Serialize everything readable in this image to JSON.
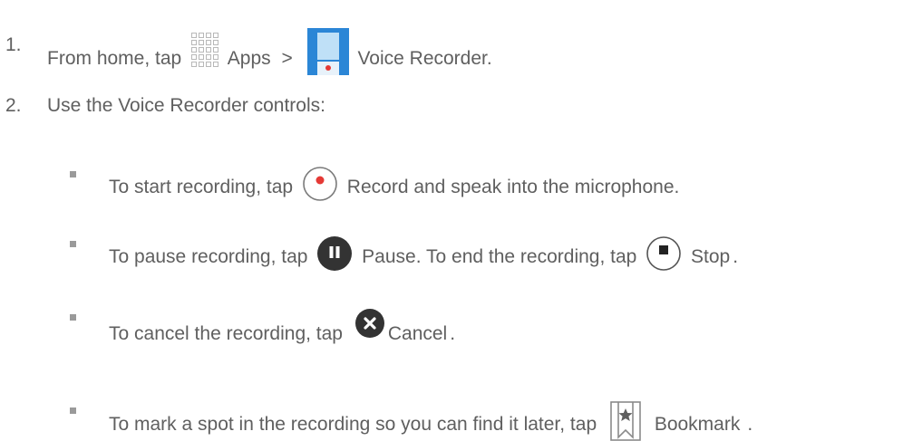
{
  "steps": [
    {
      "number": "1.",
      "text_before": "From home, tap",
      "apps_label": "Apps",
      "separator": ">",
      "recorder_label": "Voice",
      "recorder_label2": "Recorder."
    },
    {
      "number": "2.",
      "text": "Use the Voice Recorder controls:"
    }
  ],
  "bullets": [
    {
      "before": "To start recording, tap",
      "icon": "record-icon",
      "after": "Record  and speak into the microphone."
    },
    {
      "before": "To pause recording, tap",
      "icon": "pause-icon",
      "middle": "Pause. To end the recording, tap",
      "icon2": "stop-icon",
      "after": "Stop",
      "end": "."
    },
    {
      "before": "To cancel the recording, tap",
      "icon": "cancel-icon",
      "after": "Cancel",
      "end": "."
    },
    {
      "before": "To mark a spot in the recording so you can find it later, tap",
      "icon": "bookmark-icon",
      "after": "Bookmark",
      "end": "."
    }
  ],
  "colors": {
    "text": "#5f5f5f",
    "record_red": "#e53935",
    "dark_icon": "#333333",
    "recorder_blue": "#2b86d6"
  }
}
